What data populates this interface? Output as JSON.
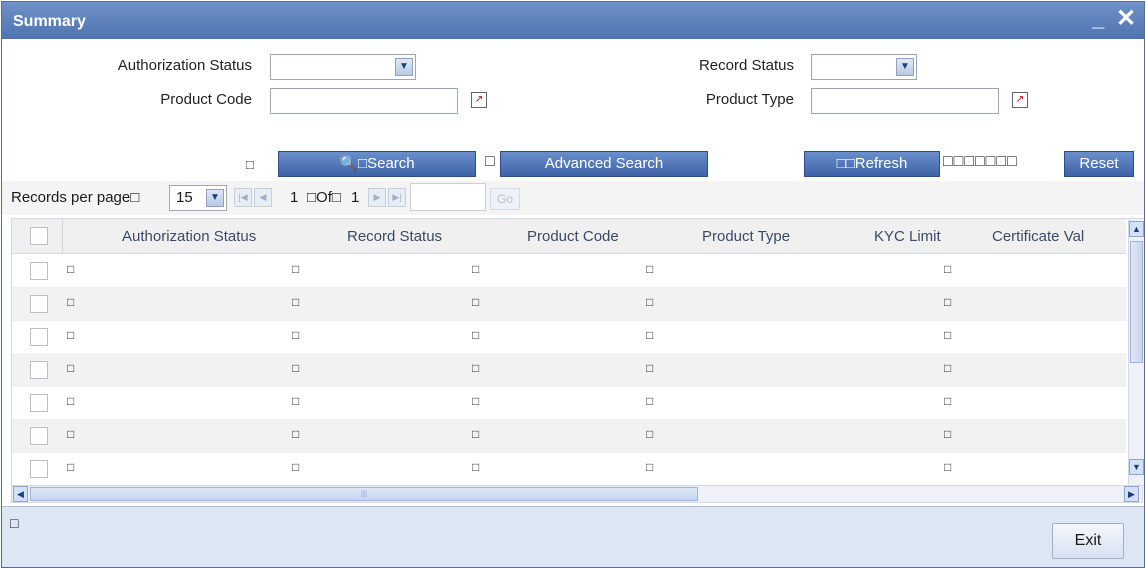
{
  "window": {
    "title": "Summary",
    "minimize": "_",
    "close": "✕"
  },
  "form": {
    "authorization_status": {
      "label": "Authorization Status",
      "value": ""
    },
    "record_status": {
      "label": "Record Status",
      "value": ""
    },
    "product_code": {
      "label": "Product Code",
      "value": ""
    },
    "product_type": {
      "label": "Product Type",
      "value": ""
    }
  },
  "toolbar": {
    "search_label": "Search",
    "search_prefix": "□",
    "advanced_search_label": "Advanced Search",
    "refresh_label": "□□Refresh",
    "reset_label": "Reset",
    "reset_prefix": "□□□□□□□",
    "sep": "□"
  },
  "pager": {
    "records_label": "Records per page□",
    "per_page": "15",
    "current_page": "1",
    "of_label": "□Of□",
    "total_pages": "1",
    "go_label": "Go"
  },
  "grid": {
    "columns": [
      "Authorization Status",
      "Record Status",
      "Product Code",
      "Product Type",
      "KYC Limit",
      "Certificate Val"
    ],
    "cell_glyph": "□",
    "rows": 7
  },
  "footer": {
    "status_glyph": "□",
    "exit_label": "Exit"
  }
}
